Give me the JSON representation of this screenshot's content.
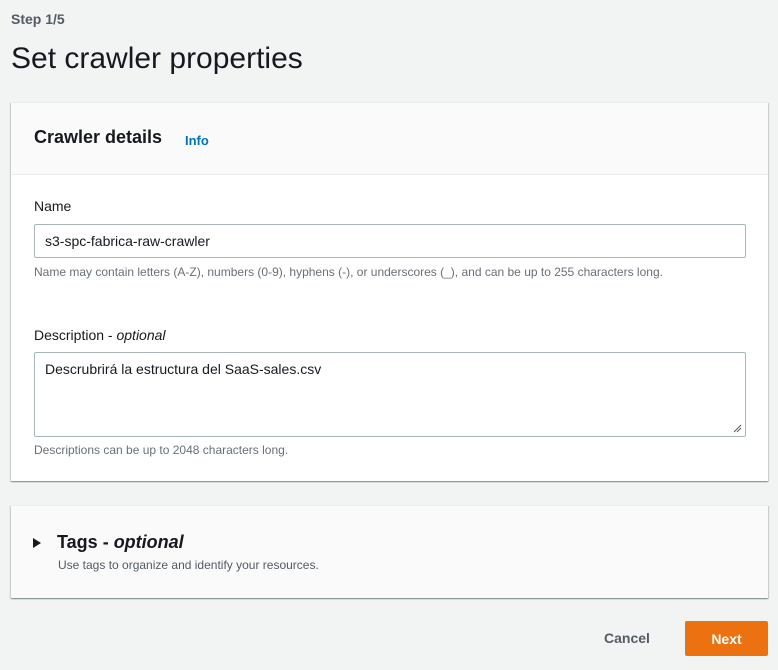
{
  "header": {
    "step": "Step 1/5",
    "title": "Set crawler properties"
  },
  "crawler_details": {
    "title": "Crawler details",
    "info_link": "Info",
    "name_label": "Name",
    "name_value": "s3-spc-fabrica-raw-crawler",
    "name_hint": "Name may contain letters (A-Z), numbers (0-9), hyphens (-), or underscores (_), and can be up to 255 characters long.",
    "description_label": "Description",
    "description_optional": "optional",
    "description_value": "Descrubrirá la estructura del SaaS-sales.csv",
    "description_hint": "Descriptions can be up to 2048 characters long."
  },
  "tags": {
    "title": "Tags",
    "optional": "optional",
    "description": "Use tags to organize and identify your resources.",
    "expanded": false
  },
  "footer": {
    "cancel_label": "Cancel",
    "next_label": "Next"
  },
  "icons": {
    "caret": "caret-right-icon",
    "resize": "resize-grip-icon"
  },
  "colors": {
    "primary_button": "#ec7211",
    "link": "#0073bb",
    "background": "#f2f3f3"
  }
}
